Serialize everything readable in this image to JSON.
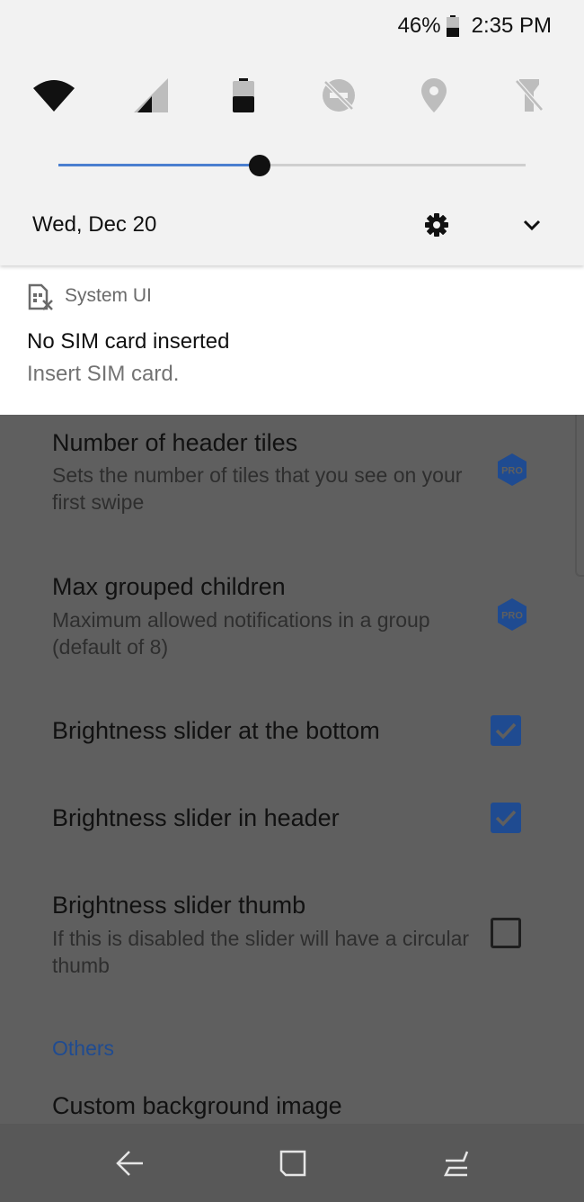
{
  "status_bar": {
    "battery_percent": "46%",
    "battery_level": 0.46,
    "time": "2:35 PM"
  },
  "quick_settings": {
    "tiles": [
      {
        "icon": "wifi-icon",
        "state": "on"
      },
      {
        "icon": "cellular-signal-icon",
        "state": "no-sim"
      },
      {
        "icon": "battery-saver-icon",
        "state": "off"
      },
      {
        "icon": "do-not-disturb-icon",
        "state": "off"
      },
      {
        "icon": "location-icon",
        "state": "off"
      },
      {
        "icon": "flashlight-icon",
        "state": "off"
      }
    ],
    "brightness_level": 0.43,
    "accent_color": "#4a7fd0",
    "date": "Wed, Dec 20"
  },
  "notification": {
    "app_name": "System UI",
    "icon": "sim-card-off-icon",
    "title": "No SIM card inserted",
    "text": "Insert SIM card."
  },
  "settings": {
    "items": [
      {
        "title": "Number of header tiles",
        "subtitle": "Sets the number of tiles that you see on your first swipe",
        "control": "pro-badge"
      },
      {
        "title": "Max grouped children",
        "subtitle": "Maximum allowed notifications in a group (default of 8)",
        "control": "pro-badge"
      },
      {
        "title": "Brightness slider at the bottom",
        "control": "checkbox",
        "checked": true
      },
      {
        "title": "Brightness slider in header",
        "control": "checkbox",
        "checked": true
      },
      {
        "title": "Brightness slider thumb",
        "subtitle": "If this is disabled the slider will have a circular thumb",
        "control": "checkbox",
        "checked": false
      }
    ],
    "pro_label": "PRO",
    "section_header": "Others",
    "next_item_title": "Custom background image",
    "accent_color": "#1f4b91"
  },
  "nav_bar": {
    "buttons": [
      "back-icon",
      "home-icon",
      "recents-icon"
    ]
  }
}
